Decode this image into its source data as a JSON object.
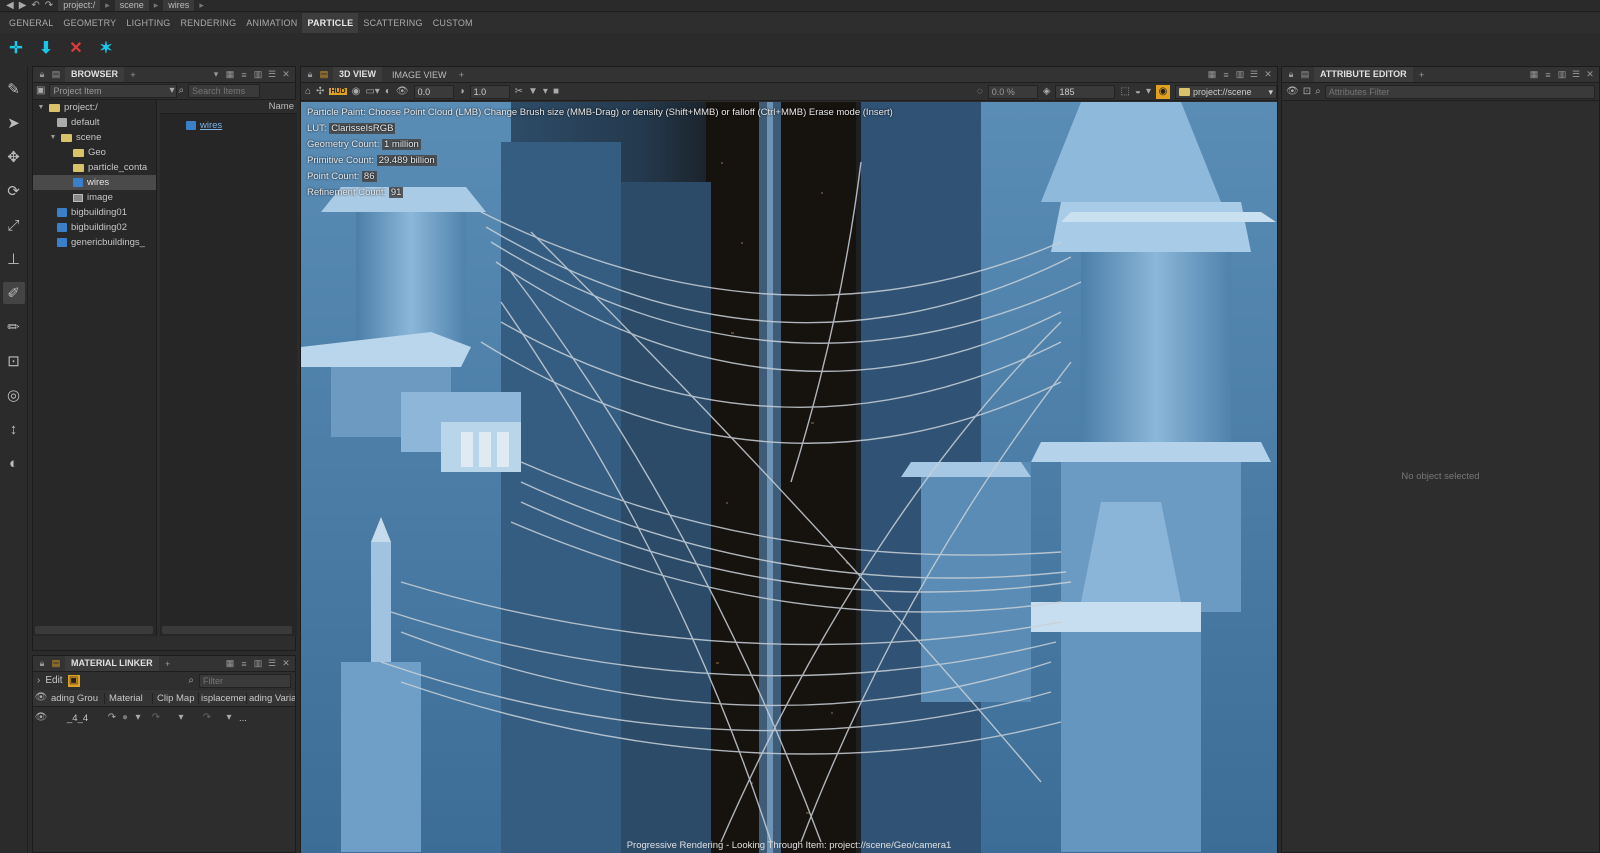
{
  "titlebar": {
    "crumbs": [
      "project:/",
      "scene",
      "wires"
    ]
  },
  "shelf": {
    "tabs": [
      "GENERAL",
      "GEOMETRY",
      "LIGHTING",
      "RENDERING",
      "ANIMATION",
      "PARTICLE",
      "SCATTERING",
      "CUSTOM"
    ],
    "active": "PARTICLE"
  },
  "shelf_tools": [
    "create-icon",
    "fill-icon",
    "delete-icon",
    "scatter-icon"
  ],
  "browser": {
    "title": "BROWSER",
    "filter_type": "Project Item",
    "search_placeholder": "Search Items",
    "column_name": "Name",
    "tree": {
      "root": "project:/",
      "default": "default",
      "scene": "scene",
      "geo": "Geo",
      "particle": "particle_conta",
      "wires": "wires",
      "image": "image",
      "bb1": "bigbuilding01",
      "bb2": "bigbuilding02",
      "generic": "genericbuildings_"
    },
    "items": [
      "wires"
    ]
  },
  "material_linker": {
    "title": "MATERIAL LINKER",
    "edit_label": "Edit",
    "filter_placeholder": "Filter",
    "columns": [
      "ading Grou",
      "Material",
      "Clip Map",
      "isplacemen",
      "ading Varia"
    ],
    "row": {
      "group": "_4_4",
      "dots": "..."
    }
  },
  "viewport": {
    "tabs": [
      "3D VIEW",
      "IMAGE VIEW"
    ],
    "active_tab": "3D VIEW",
    "toolbar": {
      "hud": "HUD",
      "value_a": "0.0",
      "value_b": "1.0",
      "percent": "0.0 %",
      "count": "185",
      "context": "project://scene"
    },
    "hint": "Particle Paint: Choose Point Cloud (LMB)  Change Brush size (MMB-Drag) or density (Shift+MMB) or falloff (Ctrl+MMB)  Erase mode (Insert)",
    "stats": [
      {
        "label": "LUT: ",
        "value": "ClarisseIsRGB"
      },
      {
        "label": "Geometry Count: ",
        "value": "1 million"
      },
      {
        "label": "Primitive Count: ",
        "value": "29.489 billion"
      },
      {
        "label": "Point Count: ",
        "value": "86"
      },
      {
        "label": "Refinement Count: ",
        "value": "91"
      }
    ],
    "status": "Progressive Rendering - Looking Through Item: project://scene/Geo/camera1"
  },
  "attribute_editor": {
    "title": "ATTRIBUTE EDITOR",
    "filter_placeholder": "Attributes Filter",
    "empty_text": "No object selected"
  },
  "colors": {
    "accent_cyan": "#19c8e8",
    "folder": "#d8c26a",
    "scene_blue": "#6aa0cc",
    "delete_red": "#e03a3a",
    "hud_orange": "#e0a020"
  }
}
